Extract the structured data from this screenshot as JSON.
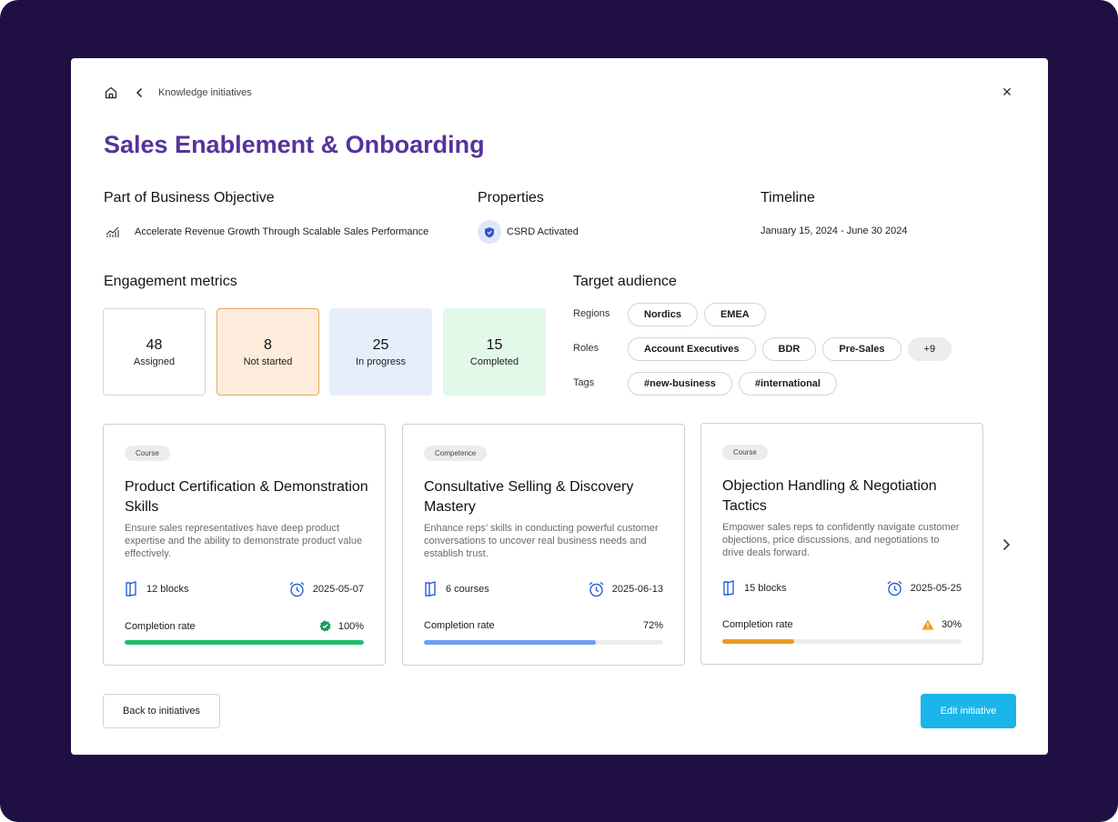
{
  "breadcrumb": {
    "label": "Knowledge initiatives"
  },
  "title": "Sales Enablement & Onboarding",
  "objective": {
    "heading": "Part of Business Objective",
    "value": "Accelerate Revenue Growth Through Scalable Sales Performance",
    "icon": "chart-growth-icon"
  },
  "properties": {
    "heading": "Properties",
    "value": "CSRD Activated",
    "icon": "shield-icon"
  },
  "timeline": {
    "heading": "Timeline",
    "value": "January 15, 2024 - June 30 2024"
  },
  "engagement": {
    "heading": "Engagement metrics",
    "metrics": [
      {
        "value": "48",
        "label": "Assigned"
      },
      {
        "value": "8",
        "label": "Not started"
      },
      {
        "value": "25",
        "label": "In progress"
      },
      {
        "value": "15",
        "label": "Completed"
      }
    ]
  },
  "audience": {
    "heading": "Target audience",
    "regions_label": "Regions",
    "regions": [
      "Nordics",
      "EMEA"
    ],
    "roles_label": "Roles",
    "roles": [
      "Account Executives",
      "BDR",
      "Pre-Sales"
    ],
    "roles_more": "+9",
    "tags_label": "Tags",
    "tags": [
      "#new-business",
      "#international"
    ]
  },
  "cards": [
    {
      "badge": "Course",
      "title": "Product Certification & Demonstration Skills",
      "description": "Ensure sales representatives have deep product expertise and the ability to demonstrate product value effectively.",
      "count": "12 blocks",
      "date": "2025-05-07",
      "completion_label": "Completion rate",
      "completion": "100%",
      "completion_value": 1.0,
      "status": "success",
      "bar_color": "#1dbf6b"
    },
    {
      "badge": "Competence",
      "title": "Consultative Selling & Discovery Mastery",
      "description": "Enhance reps’ skills in conducting powerful customer conversations to uncover real business needs and establish trust.",
      "count": "6 courses",
      "date": "2025-06-13",
      "completion_label": "Completion rate",
      "completion": "72%",
      "completion_value": 0.72,
      "status": "none",
      "bar_color": "#6b9ef0"
    },
    {
      "badge": "Course",
      "title": "Objection Handling & Negotiation Tactics",
      "description": "Empower sales reps to confidently navigate customer objections, price discussions, and negotiations to drive deals forward.",
      "count": "15 blocks",
      "date": "2025-05-25",
      "completion_label": "Completion rate",
      "completion": "30%",
      "completion_value": 0.3,
      "status": "warning",
      "bar_color": "#eb9a24"
    }
  ],
  "buttons": {
    "back": "Back to initiatives",
    "edit": "Edit initiative"
  },
  "colors": {
    "title": "#55339c",
    "primary": "#1ab5eb",
    "frame": "#200f43"
  }
}
